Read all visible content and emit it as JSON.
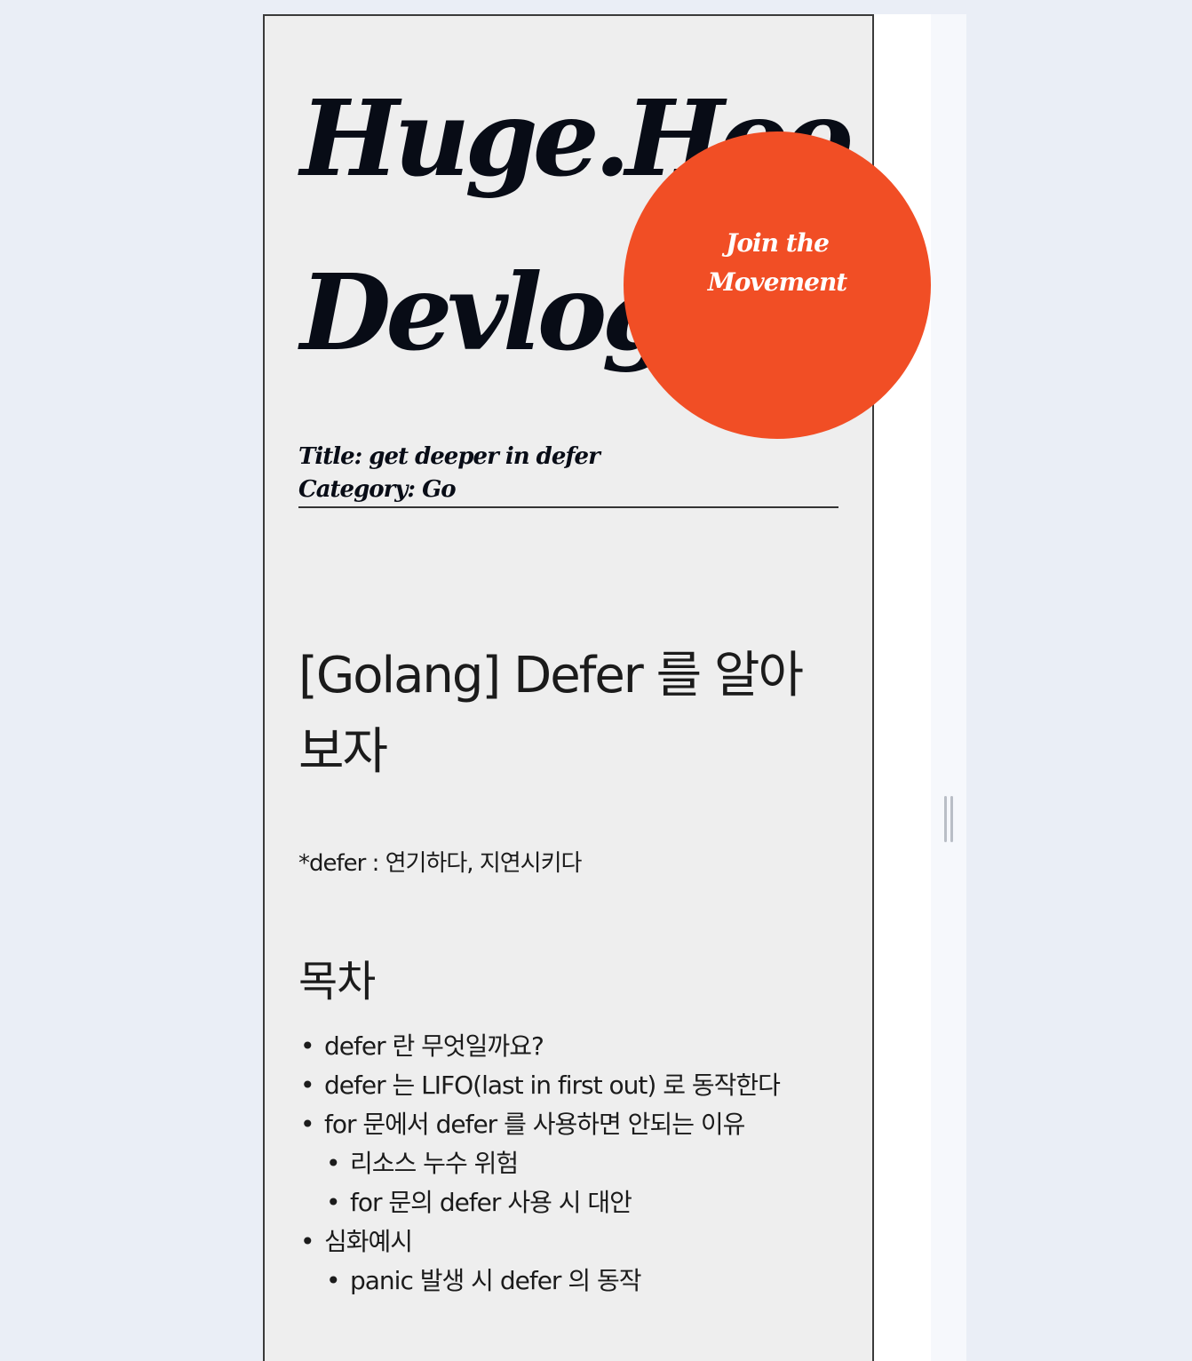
{
  "blog": {
    "logo_line1": "Huge.Hoo",
    "logo_line2": "Devlog"
  },
  "cta": {
    "label": "Join the Movement",
    "color": "#f14e25"
  },
  "post_meta": {
    "title_line": "Title: get deeper in defer",
    "category_line": "Category: Go"
  },
  "article": {
    "heading": "[Golang] Defer 를 알아보자",
    "definition": "*defer : 연기하다, 지연시키다",
    "toc_heading": "목차",
    "toc_items": [
      "defer 란 무엇일까요?",
      "defer 는 LIFO(last in first out) 로 동작한다",
      "for 문에서 defer 를 사용하면 안되는 이유",
      "리소스 누수 위험",
      "for 문의 defer 사용 시 대안",
      "심화예시",
      "panic 발생 시 defer 의 동작"
    ]
  }
}
